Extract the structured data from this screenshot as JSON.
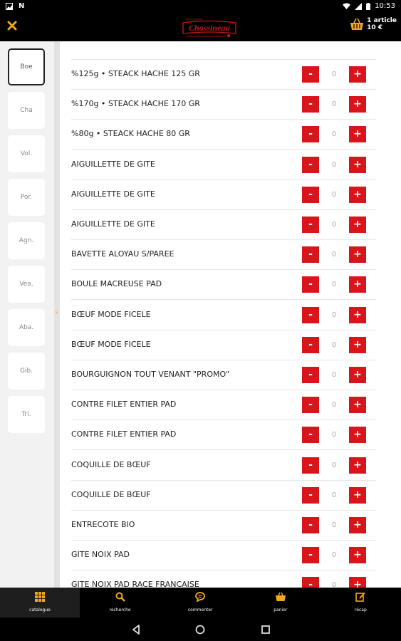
{
  "status_bar": {
    "time": "10:53"
  },
  "header": {
    "logo_text": "Chassineau",
    "cart": {
      "count_label": "1 article",
      "total_label": "10 €"
    }
  },
  "categories": [
    {
      "label": "Boe",
      "active": true
    },
    {
      "label": "Cha"
    },
    {
      "label": "Vol."
    },
    {
      "label": "Por."
    },
    {
      "label": "Agn."
    },
    {
      "label": "Vea."
    },
    {
      "label": "Aba."
    },
    {
      "label": "Gib."
    },
    {
      "label": "Tri."
    }
  ],
  "products": [
    {
      "name": "%125g • STEACK HACHE 125 GR",
      "qty": "0"
    },
    {
      "name": "%170g • STEACK HACHE 170 GR",
      "qty": "0"
    },
    {
      "name": "%80g • STEACK HACHE 80 GR",
      "qty": "0"
    },
    {
      "name": "AIGUILLETTE DE GITE",
      "qty": "0"
    },
    {
      "name": "AIGUILLETTE DE GITE",
      "qty": "0"
    },
    {
      "name": "AIGUILLETTE DE GITE",
      "qty": "0"
    },
    {
      "name": "BAVETTE ALOYAU S/PAREE",
      "qty": "0"
    },
    {
      "name": "BOULE MACREUSE PAD",
      "qty": "0"
    },
    {
      "name": "BŒUF MODE FICELE",
      "qty": "0"
    },
    {
      "name": "BŒUF MODE FICELE",
      "qty": "0"
    },
    {
      "name": "BOURGUIGNON TOUT VENANT \"PROMO\"",
      "qty": "0"
    },
    {
      "name": "CONTRE FILET ENTIER PAD",
      "qty": "0"
    },
    {
      "name": "CONTRE FILET ENTIER PAD",
      "qty": "0"
    },
    {
      "name": "COQUILLE DE BŒUF",
      "qty": "0"
    },
    {
      "name": "COQUILLE DE BŒUF",
      "qty": "0"
    },
    {
      "name": "ENTRECOTE BIO",
      "qty": "0"
    },
    {
      "name": "GITE NOIX PAD",
      "qty": "0"
    },
    {
      "name": "GITE NOIX PAD RACE FRANCAISE",
      "qty": "0"
    }
  ],
  "stepper": {
    "minus": "-",
    "plus": "+"
  },
  "bottom_nav": [
    {
      "label": "catalogue",
      "icon": "grid-icon",
      "active": true
    },
    {
      "label": "recherche",
      "icon": "search-icon"
    },
    {
      "label": "commenter",
      "icon": "comment-icon"
    },
    {
      "label": "panier",
      "icon": "basket-icon"
    },
    {
      "label": "récap",
      "icon": "edit-icon"
    }
  ],
  "colors": {
    "accent": "#f0a81c",
    "button_red": "#d9151c",
    "logo_red": "#c4161c"
  }
}
